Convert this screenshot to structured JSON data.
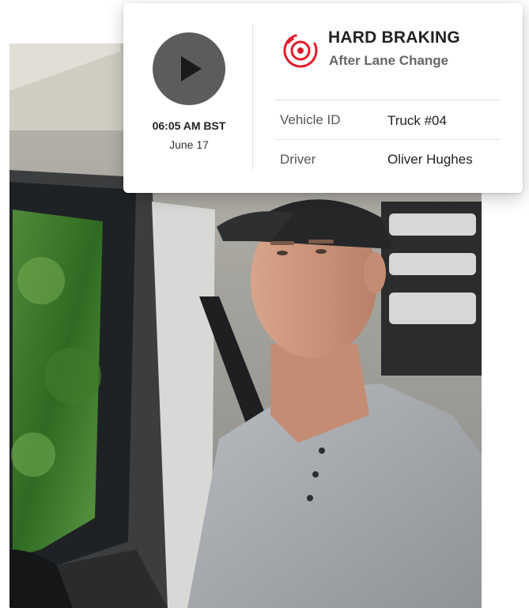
{
  "event": {
    "play_icon": "play-icon",
    "time": "06:05 AM BST",
    "date": "June 17",
    "title": "HARD BRAKING",
    "subtitle": "After Lane Change",
    "icon": "brake-alert-icon",
    "accent_color": "#e11d2a"
  },
  "details": [
    {
      "label": "Vehicle ID",
      "value": "Truck #04"
    },
    {
      "label": "Driver",
      "value": "Oliver Hughes"
    }
  ],
  "photo": {
    "description_icon": "driver-photo"
  }
}
